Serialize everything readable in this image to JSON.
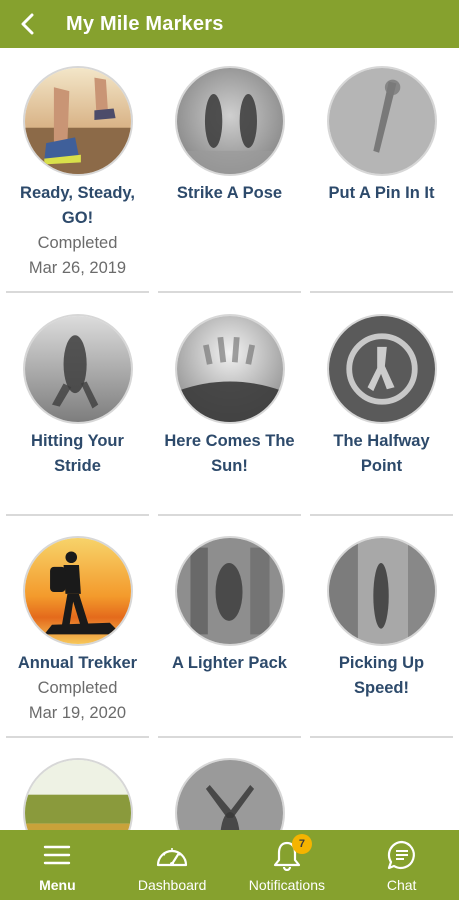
{
  "header": {
    "title": "My Mile Markers"
  },
  "markers": [
    {
      "title": "Ready, Steady, GO!",
      "status": "Completed",
      "date": "Mar 26, 2019",
      "earned": true,
      "art": "running-shoes"
    },
    {
      "title": "Strike A Pose",
      "status": "",
      "date": "",
      "earned": false,
      "art": "two-figures"
    },
    {
      "title": "Put A Pin In It",
      "status": "",
      "date": "",
      "earned": false,
      "art": "pin"
    },
    {
      "title": "Hitting Your Stride",
      "status": "",
      "date": "",
      "earned": false,
      "art": "runner"
    },
    {
      "title": "Here Comes The Sun!",
      "status": "",
      "date": "",
      "earned": false,
      "art": "sunrise"
    },
    {
      "title": "The Halfway Point",
      "status": "",
      "date": "",
      "earned": false,
      "art": "halfway-sign"
    },
    {
      "title": "Annual Trekker",
      "status": "Completed",
      "date": "Mar 19, 2020",
      "earned": true,
      "art": "hiker-sunset"
    },
    {
      "title": "A Lighter Pack",
      "status": "",
      "date": "",
      "earned": false,
      "art": "pack"
    },
    {
      "title": "Picking Up Speed!",
      "status": "",
      "date": "",
      "earned": false,
      "art": "trail"
    },
    {
      "title": "",
      "status": "",
      "date": "",
      "earned": true,
      "art": "field"
    },
    {
      "title": "",
      "status": "",
      "date": "",
      "earned": false,
      "art": "arms-raised"
    }
  ],
  "nav": {
    "menu": "Menu",
    "dashboard": "Dashboard",
    "notifications": "Notifications",
    "notifications_count": "7",
    "chat": "Chat"
  },
  "colors": {
    "brand": "#86a12e",
    "title_text": "#2d4a6b",
    "muted_text": "#6b6b6b",
    "badge": "#f5b400"
  }
}
